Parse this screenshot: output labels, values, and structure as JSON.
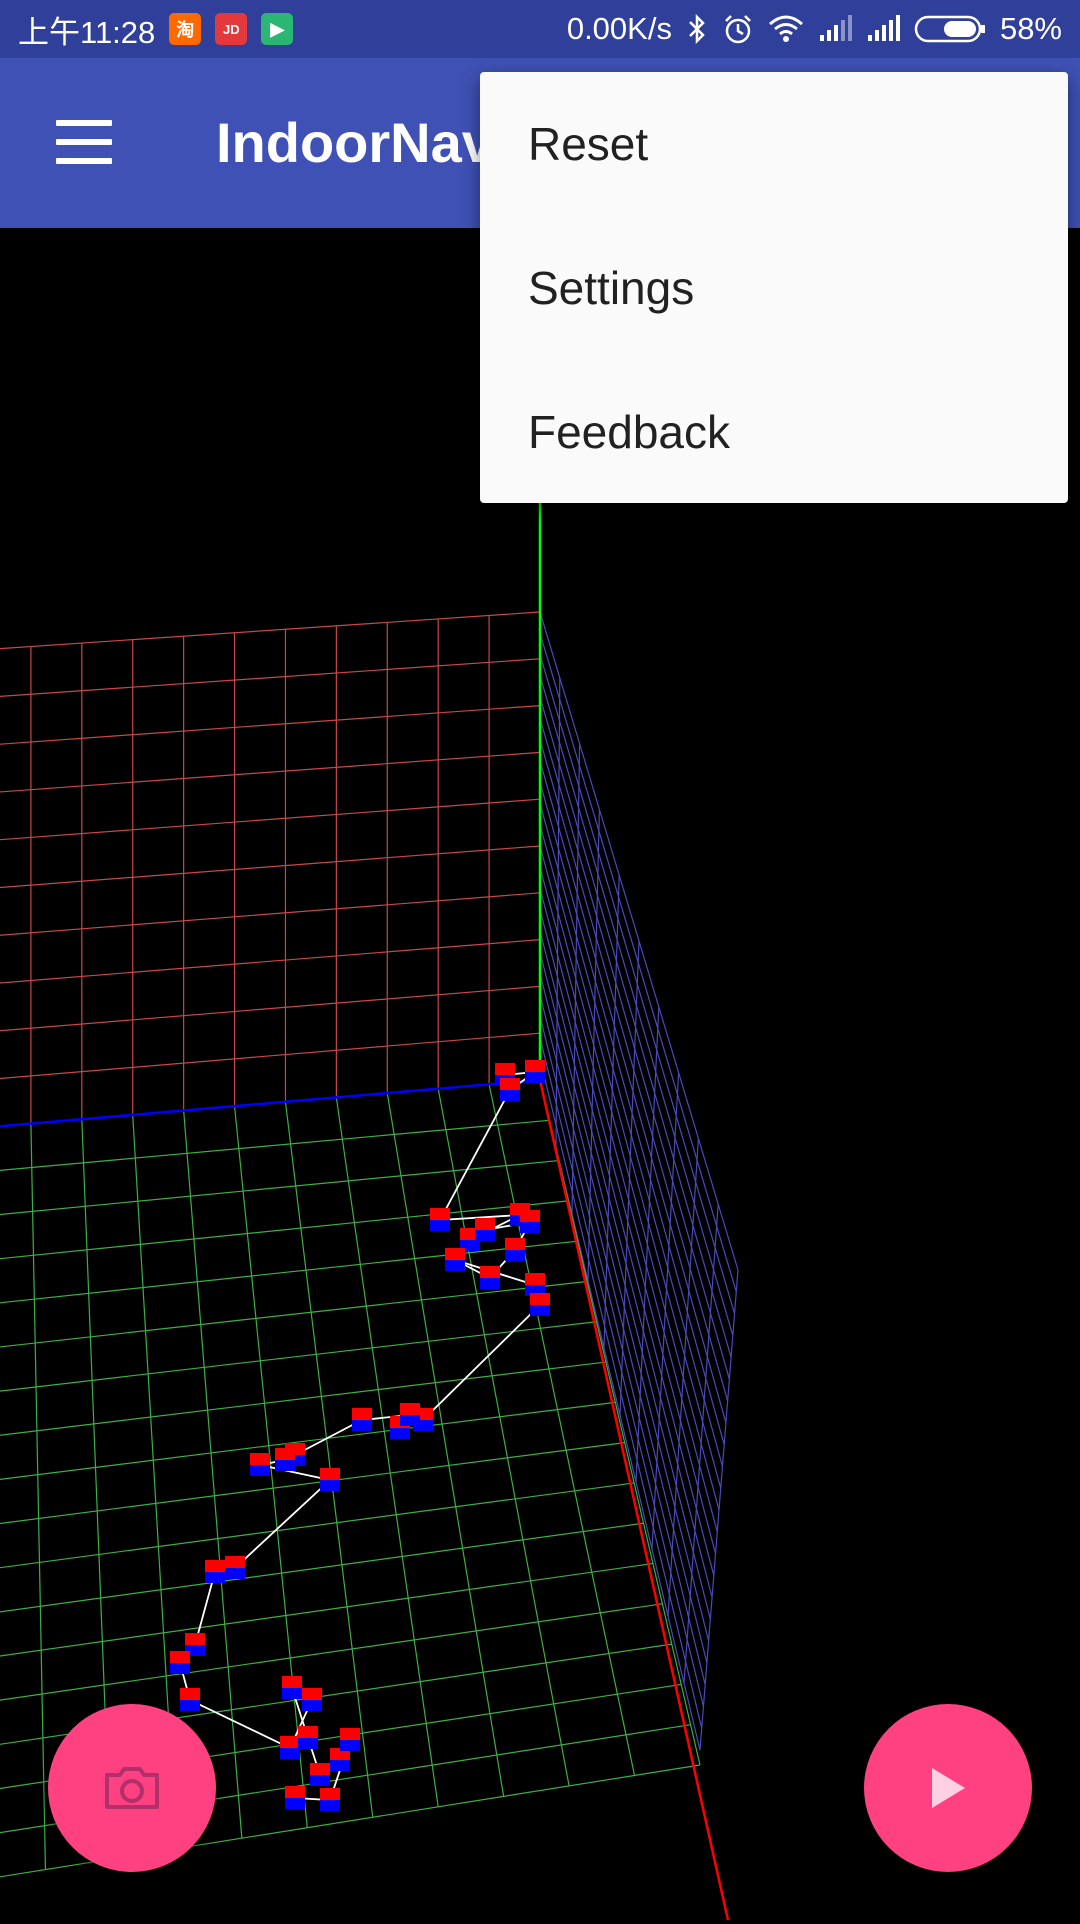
{
  "status_bar": {
    "time": "上午11:28",
    "network_speed": "0.00K/s",
    "battery": "58%",
    "apps": [
      {
        "label": "淘",
        "color": "#ff6a00"
      },
      {
        "label": "JD",
        "color": "#e4393c"
      },
      {
        "label": "▶",
        "color": "#2bb673"
      }
    ]
  },
  "app_bar": {
    "title": "IndoorNav"
  },
  "overflow_menu": {
    "items": [
      "Reset",
      "Settings",
      "Feedback"
    ]
  },
  "fabs": {
    "camera_icon": "camera-icon",
    "play_icon": "play-icon",
    "color": "#ff4081"
  },
  "scene": {
    "background": "#000000",
    "floor_grid_color": "#3cb043",
    "back_wall_color": "#c84848",
    "side_wall_color": "#4a4ab8",
    "axis_y_color": "#00ff00",
    "axis_x_color": "#ff0000",
    "axis_z_color": "#0000ff",
    "path_color": "#ffffff",
    "marker_top_color": "#ff0000",
    "marker_bottom_color": "#0000ff"
  }
}
